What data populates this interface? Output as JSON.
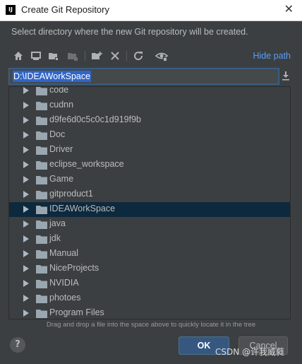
{
  "window": {
    "title": "Create Git Repository",
    "app_icon_text": "IJ",
    "close_glyph": "✕"
  },
  "description": "Select directory where the new Git repository will be created.",
  "toolbar": {
    "icons": [
      "home-icon",
      "desktop-icon",
      "project-folder-icon",
      "module-folder-icon",
      "new-folder-icon",
      "delete-icon",
      "refresh-icon",
      "show-hidden-icon"
    ],
    "hide_path_label": "Hide path"
  },
  "path": {
    "value": "D:\\IDEAWorkSpace",
    "icon": "download-icon"
  },
  "tree": {
    "items": [
      {
        "label": "code",
        "selected": false
      },
      {
        "label": "cudnn",
        "selected": false
      },
      {
        "label": "d9fe6d0c5c0c1d919f9b",
        "selected": false
      },
      {
        "label": "Doc",
        "selected": false
      },
      {
        "label": "Driver",
        "selected": false
      },
      {
        "label": "eclipse_workspace",
        "selected": false
      },
      {
        "label": "Game",
        "selected": false
      },
      {
        "label": "gitproduct1",
        "selected": false
      },
      {
        "label": "IDEAWorkSpace",
        "selected": true
      },
      {
        "label": "java",
        "selected": false
      },
      {
        "label": "jdk",
        "selected": false
      },
      {
        "label": "Manual",
        "selected": false
      },
      {
        "label": "NiceProjects",
        "selected": false
      },
      {
        "label": "NVIDIA",
        "selected": false
      },
      {
        "label": "photoes",
        "selected": false
      },
      {
        "label": "Program Files",
        "selected": false
      }
    ]
  },
  "hint": "Drag and drop a file into the space above to quickly locate it in the tree",
  "buttons": {
    "help": "?",
    "ok": "OK",
    "cancel": "Cancel"
  },
  "watermark": "CSDN @许我威蕤",
  "colors": {
    "background": "#3c3f41",
    "accent": "#589df6",
    "selection": "#0d293e",
    "primary_button": "#365880"
  }
}
